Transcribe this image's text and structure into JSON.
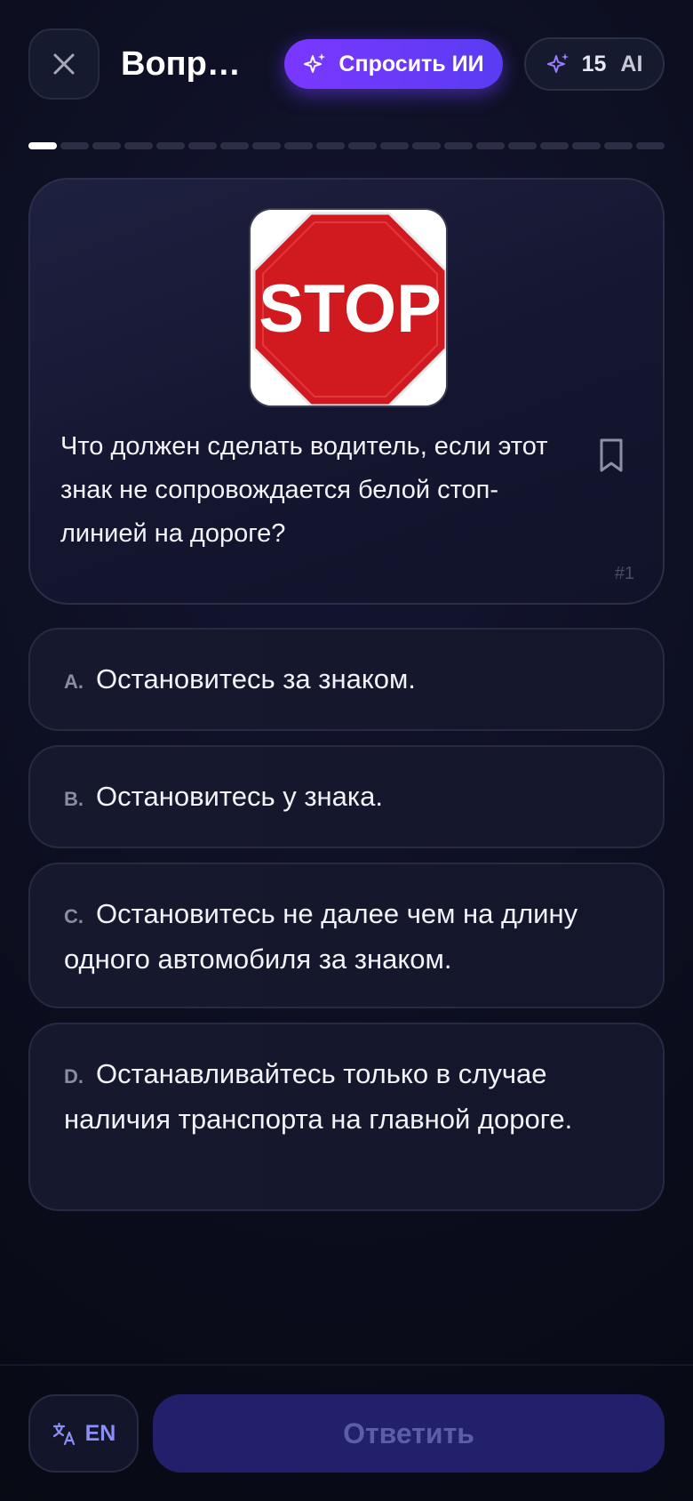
{
  "header": {
    "title": "Вопро...",
    "ask_ai_label": "Спросить ИИ",
    "credits_count": "15",
    "credits_label": "AI"
  },
  "progress": {
    "current": 1,
    "total": 20
  },
  "question": {
    "sign_text": "STOP",
    "text": "Что должен сделать водитель, если этот знак не сопровождается белой стоп-линией на дороге?",
    "number": "#1"
  },
  "options": [
    {
      "letter": "A.",
      "text": "Остановитесь за знаком."
    },
    {
      "letter": "B.",
      "text": "Остановитесь у знака."
    },
    {
      "letter": "C.",
      "text": "Остановитесь не далее чем на длину одного автомобиля за знаком."
    },
    {
      "letter": "D.",
      "text": "Останавливайтесь только в случае наличия транспорта на главной дороге."
    }
  ],
  "footer": {
    "language_label": "EN",
    "answer_label": "Ответить"
  },
  "colors": {
    "accent": "#7a37ff",
    "answer_disabled_bg": "#221f6b",
    "sign_red": "#d11a1f"
  }
}
